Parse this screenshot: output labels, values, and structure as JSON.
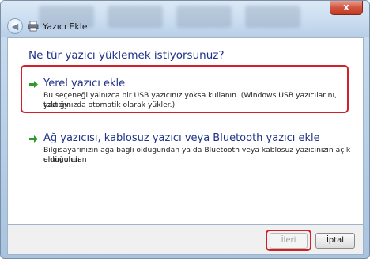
{
  "window": {
    "title": "Yazıcı Ekle",
    "close_label": "x"
  },
  "dialog": {
    "heading": "Ne tür yazıcı yüklemek istiyorsunuz?",
    "options": [
      {
        "title": "Yerel yazıcı ekle",
        "description_line1": "Bu seçeneği yalnızca bir USB yazıcınız yoksa kullanın. (Windows USB yazıcılarını, yazıcıyı",
        "description_line2": "taktığınızda otomatik olarak yükler.)"
      },
      {
        "title": "Ağ yazıcısı, kablosuz yazıcı veya Bluetooth yazıcı ekle",
        "description_line1": "Bilgisayarınızın ağa bağlı olduğundan ya da Bluetooth veya kablosuz yazıcınızın açık olduğundan",
        "description_line2": "emin olun."
      }
    ]
  },
  "footer": {
    "next_label": "İleri",
    "cancel_label": "İptal"
  },
  "colors": {
    "heading": "#1e3287",
    "arrow": "#2e9a2e",
    "highlight": "#d0212a"
  }
}
